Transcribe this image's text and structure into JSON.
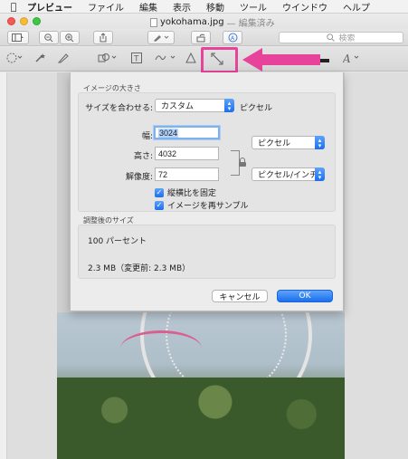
{
  "menubar": {
    "apple": "",
    "items": [
      "プレビュー",
      "ファイル",
      "編集",
      "表示",
      "移動",
      "ツール",
      "ウインドウ",
      "ヘルプ"
    ]
  },
  "window": {
    "filename": "yokohama.jpg",
    "edited": "— 編集済み"
  },
  "toolbar": {
    "search_placeholder": "検索"
  },
  "dialog": {
    "image_size_title": "イメージの大きさ",
    "fit_label": "サイズを合わせる:",
    "fit_value": "カスタム",
    "fit_unit": "ピクセル",
    "width_label": "幅:",
    "width_value": "3024",
    "height_label": "高さ:",
    "height_value": "4032",
    "unit_value": "ピクセル",
    "resolution_label": "解像度:",
    "resolution_value": "72",
    "resolution_unit": "ピクセル/インチ",
    "scale_proportionally": "縦横比を固定",
    "resample_image": "イメージを再サンプル",
    "result_title": "調整後のサイズ",
    "percent": "100 パーセント",
    "filesize": "2.3 MB（変更前: 2.3 MB）",
    "cancel_label": "キャンセル",
    "ok_label": "OK"
  },
  "colors": {
    "highlight": "#e7439a",
    "accent": "#1b6fef"
  }
}
